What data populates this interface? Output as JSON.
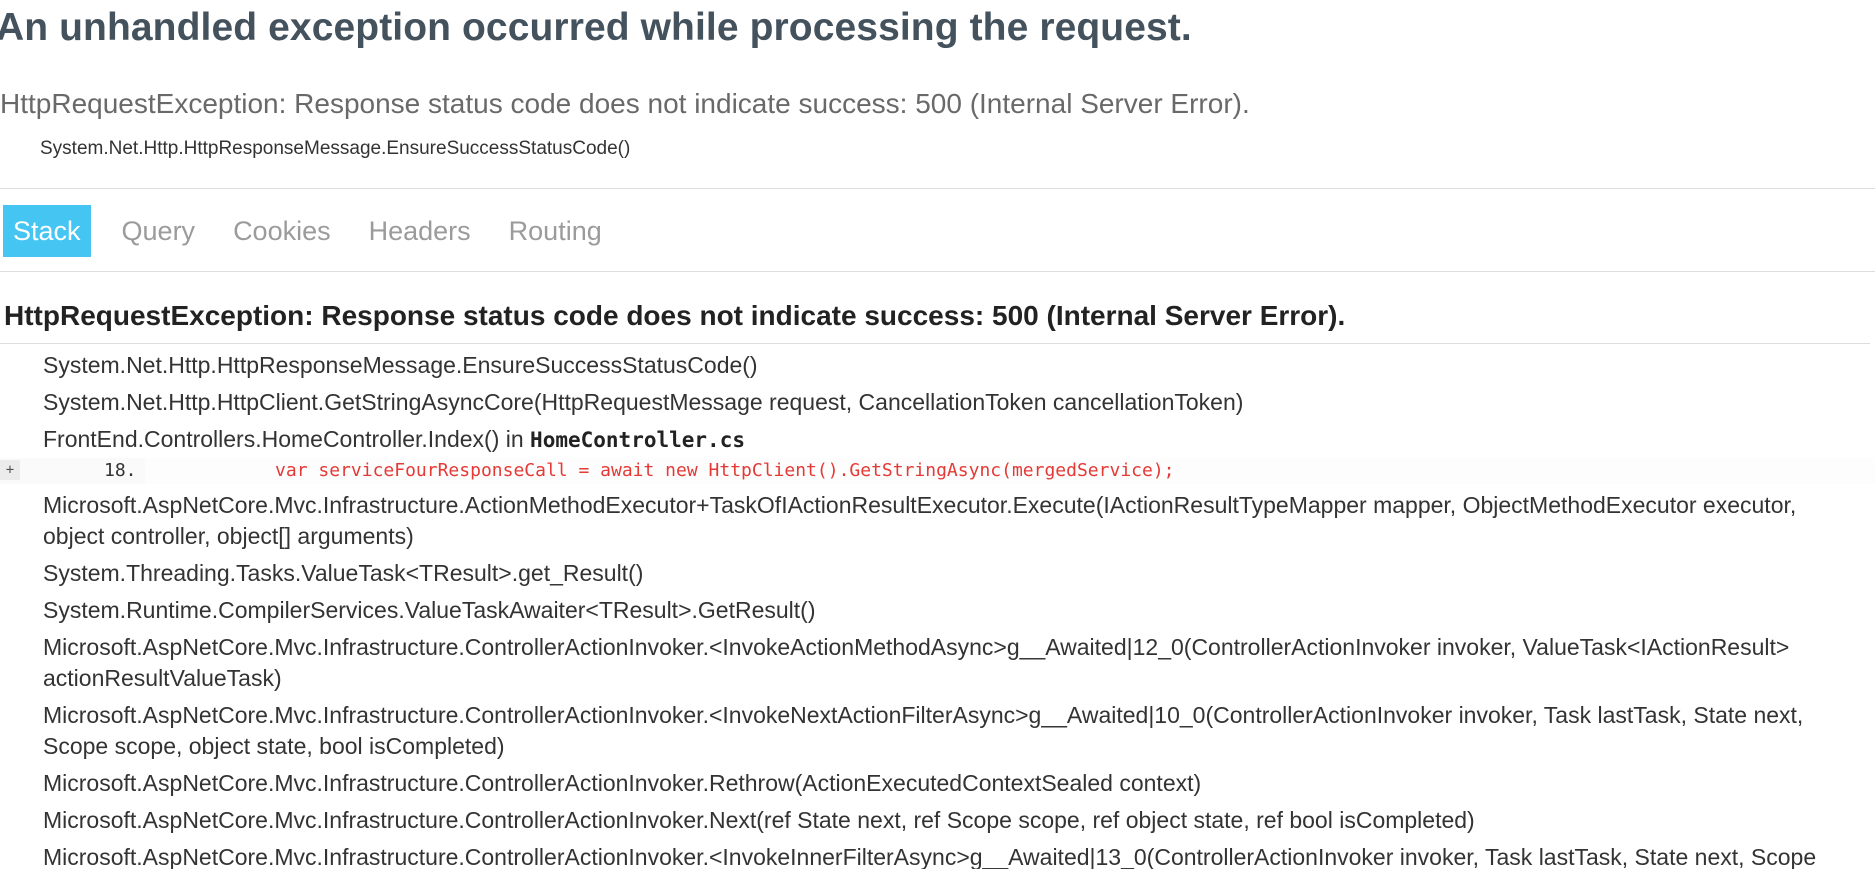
{
  "page": {
    "title": "An unhandled exception occurred while processing the request.",
    "exception_summary": "HttpRequestException: Response status code does not indicate success: 500 (Internal Server Error).",
    "exception_location": "System.Net.Http.HttpResponseMessage.EnsureSuccessStatusCode()"
  },
  "tabs": [
    {
      "label": "Stack",
      "selected": true
    },
    {
      "label": "Query",
      "selected": false
    },
    {
      "label": "Cookies",
      "selected": false
    },
    {
      "label": "Headers",
      "selected": false
    },
    {
      "label": "Routing",
      "selected": false
    }
  ],
  "stack": {
    "heading": "HttpRequestException: Response status code does not indicate success: 500 (Internal Server Error).",
    "frames": [
      {
        "text": "System.Net.Http.HttpResponseMessage.EnsureSuccessStatusCode()"
      },
      {
        "text": "System.Net.Http.HttpClient.GetStringAsyncCore(HttpRequestMessage request, CancellationToken cancellationToken)"
      },
      {
        "text": "FrontEnd.Controllers.HomeController.Index() in ",
        "file": "HomeController.cs"
      },
      {
        "text": "Microsoft.AspNetCore.Mvc.Infrastructure.ActionMethodExecutor+TaskOfIActionResultExecutor.Execute(IActionResultTypeMapper mapper, ObjectMethodExecutor executor, object controller, object[] arguments)"
      },
      {
        "text": "System.Threading.Tasks.ValueTask<TResult>.get_Result()"
      },
      {
        "text": "System.Runtime.CompilerServices.ValueTaskAwaiter<TResult>.GetResult()"
      },
      {
        "text": "Microsoft.AspNetCore.Mvc.Infrastructure.ControllerActionInvoker.<InvokeActionMethodAsync>g__Awaited|12_0(ControllerActionInvoker invoker, ValueTask<IActionResult> actionResultValueTask)"
      },
      {
        "text": "Microsoft.AspNetCore.Mvc.Infrastructure.ControllerActionInvoker.<InvokeNextActionFilterAsync>g__Awaited|10_0(ControllerActionInvoker invoker, Task lastTask, State next, Scope scope, object state, bool isCompleted)"
      },
      {
        "text": "Microsoft.AspNetCore.Mvc.Infrastructure.ControllerActionInvoker.Rethrow(ActionExecutedContextSealed context)"
      },
      {
        "text": "Microsoft.AspNetCore.Mvc.Infrastructure.ControllerActionInvoker.Next(ref State next, ref Scope scope, ref object state, ref bool isCompleted)"
      },
      {
        "text": "Microsoft.AspNetCore.Mvc.Infrastructure.ControllerActionInvoker.<InvokeInnerFilterAsync>g__Awaited|13_0(ControllerActionInvoker invoker, Task lastTask, State next, Scope scope,"
      }
    ],
    "code_snippet": {
      "expander": "+",
      "line_number": "18.",
      "code": "            var serviceFourResponseCall = await new HttpClient().GetStringAsync(mergedService);"
    }
  },
  "colors": {
    "title": "#44525e",
    "tab_selected_bg": "#44c5f2",
    "tab_text": "#9b9b9b",
    "code_highlight": "#e53935"
  }
}
